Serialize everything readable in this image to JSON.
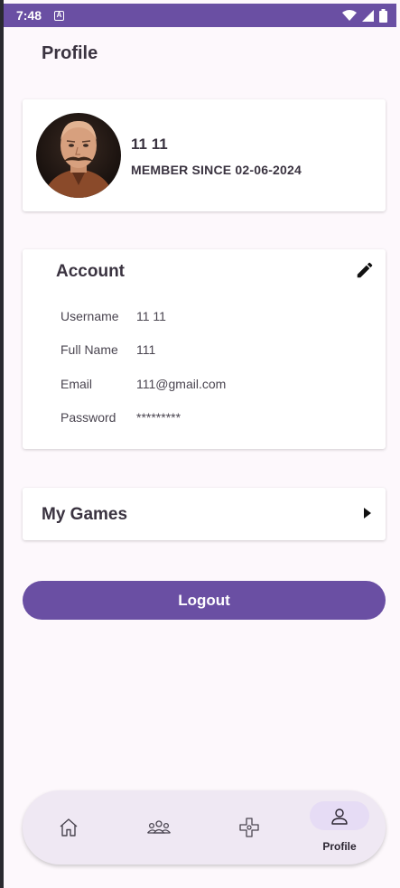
{
  "status_bar": {
    "time": "7:48",
    "notification_icon": "a-icon"
  },
  "page": {
    "title": "Profile"
  },
  "profile": {
    "name": "11 11",
    "member_since": "MEMBER SINCE 02-06-2024"
  },
  "account": {
    "title": "Account",
    "fields": [
      {
        "label": "Username",
        "value": "11 11"
      },
      {
        "label": "Full Name",
        "value": "111"
      },
      {
        "label": "Email",
        "value": "111@gmail.com"
      },
      {
        "label": "Password",
        "value": "*********"
      }
    ]
  },
  "games": {
    "title": "My Games"
  },
  "logout": {
    "label": "Logout"
  },
  "bottom_nav": {
    "items": [
      {
        "icon": "home-icon"
      },
      {
        "icon": "community-icon"
      },
      {
        "icon": "games-icon"
      },
      {
        "icon": "profile-icon",
        "label": "Profile",
        "active": true
      }
    ]
  },
  "colors": {
    "accent": "#6a4fa3",
    "background": "#fdf8fc",
    "active_pill": "#e6dcf5"
  }
}
